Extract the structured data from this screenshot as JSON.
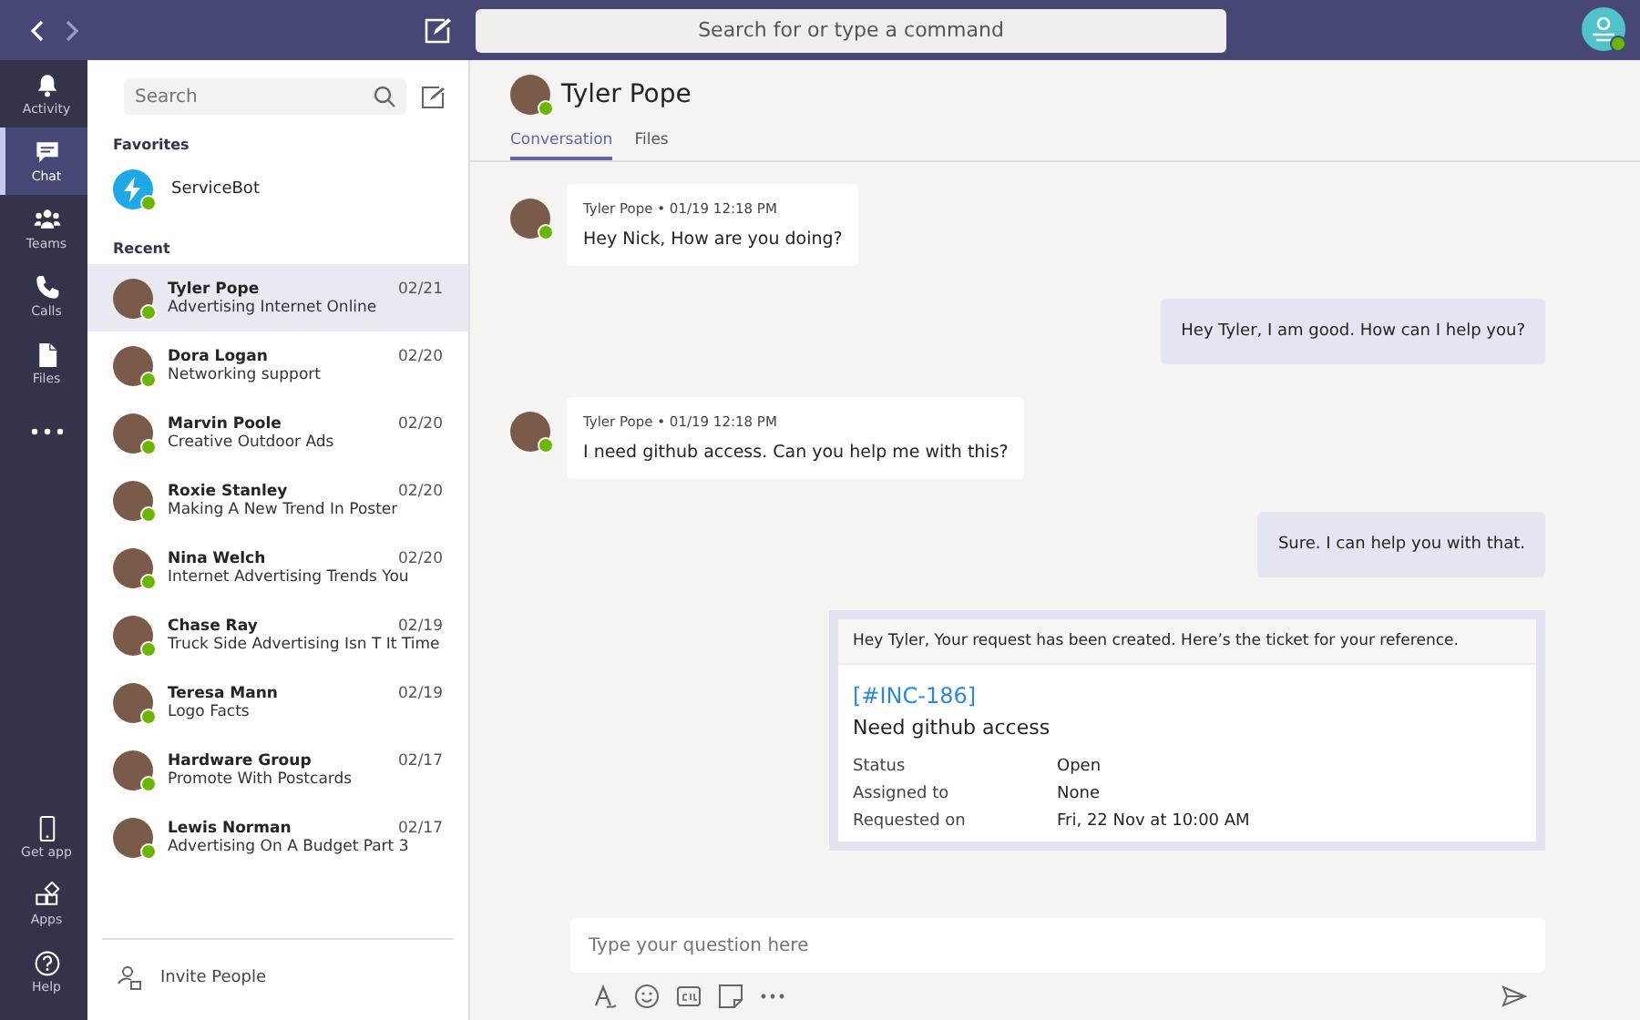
{
  "top_bar": {
    "search_placeholder": "Search for or type a command"
  },
  "rail": {
    "items": [
      {
        "label": "Activity",
        "selected": false
      },
      {
        "label": "Chat",
        "selected": true
      },
      {
        "label": "Teams",
        "selected": false
      },
      {
        "label": "Calls",
        "selected": false
      },
      {
        "label": "Files",
        "selected": false
      },
      {
        "selected": false
      }
    ],
    "bottom_items": [
      {
        "label": "Get app"
      },
      {
        "label": "Apps"
      },
      {
        "label": "Help"
      }
    ]
  },
  "chat_list": {
    "search_placeholder": "Search",
    "favorites_label": "Favorites",
    "favorites": [
      {
        "name": "ServiceBot",
        "online": true
      }
    ],
    "recent_label": "Recent",
    "recent": [
      {
        "name": "Tyler Pope",
        "preview": "Advertising Internet Online",
        "date": "02/21",
        "online": true,
        "selected": true
      },
      {
        "name": "Dora Logan",
        "preview": "Networking support",
        "date": "02/20",
        "online": true,
        "selected": false
      },
      {
        "name": "Marvin Poole",
        "preview": "Creative Outdoor Ads",
        "date": "02/20",
        "online": true,
        "selected": false
      },
      {
        "name": "Roxie Stanley",
        "preview": "Making A New Trend In Poster",
        "date": "02/20",
        "online": true,
        "selected": false
      },
      {
        "name": "Nina Welch",
        "preview": "Internet Advertising Trends You",
        "date": "02/20",
        "online": true,
        "selected": false
      },
      {
        "name": "Chase Ray",
        "preview": "Truck Side Advertising Isn T It Time",
        "date": "02/19",
        "online": true,
        "selected": false
      },
      {
        "name": "Teresa Mann",
        "preview": "Logo Facts",
        "date": "02/19",
        "online": true,
        "selected": false
      },
      {
        "name": "Hardware Group",
        "preview": "Promote With Postcards",
        "date": "02/17",
        "online": true,
        "selected": false
      },
      {
        "name": "Lewis Norman",
        "preview": "Advertising On A Budget Part 3",
        "date": "02/17",
        "online": true,
        "selected": false
      }
    ],
    "invite_label": "Invite People"
  },
  "conversation": {
    "title": "Tyler Pope",
    "online": true,
    "tabs": [
      {
        "label": "Conversation",
        "selected": true
      },
      {
        "label": "Files",
        "selected": false
      }
    ],
    "messages": [
      {
        "kind": "incoming",
        "author": "Tyler Pope • 01/19 12:18 PM",
        "text": "Hey Nick, How are you doing?",
        "online": true
      },
      {
        "kind": "outgoing",
        "text": "Hey Tyler, I am good. How can I help you?"
      },
      {
        "kind": "incoming",
        "author": "Tyler Pope • 01/19 12:18 PM",
        "text": "I need github access. Can you help me with this?",
        "online": true
      },
      {
        "kind": "outgoing",
        "text": "Sure. I can help you with that."
      },
      {
        "kind": "card",
        "header": "Hey Tyler, Your request has been created. Here’s the ticket for your reference.",
        "ticket_id": "[#INC-186]",
        "ticket_title": "Need github access",
        "fields": [
          {
            "label": "Status",
            "value": "Open"
          },
          {
            "label": "Assigned to",
            "value": "None"
          },
          {
            "label": "Requested on",
            "value": "Fri, 22 Nov at 10:00 AM"
          }
        ]
      }
    ],
    "compose_placeholder": "Type your question here"
  }
}
